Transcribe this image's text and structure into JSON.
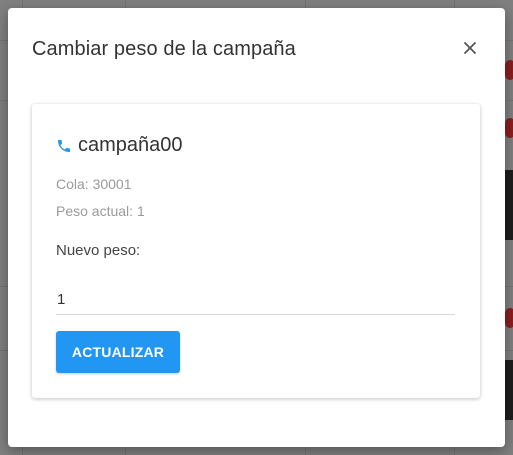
{
  "modal": {
    "title": "Cambiar peso de la campaña",
    "close_icon": "close-icon"
  },
  "campaign": {
    "icon": "phone-icon",
    "name": "campaña00",
    "queue_text": "Cola: 30001",
    "current_weight_text": "Peso actual: 1"
  },
  "form": {
    "new_weight_label": "Nuevo peso:",
    "new_weight_value": "1",
    "submit_label": "ACTUALIZAR"
  },
  "colors": {
    "accent": "#2196f3",
    "text_primary": "#333333",
    "text_muted": "#9a9a9a",
    "overlay": "#808080"
  }
}
